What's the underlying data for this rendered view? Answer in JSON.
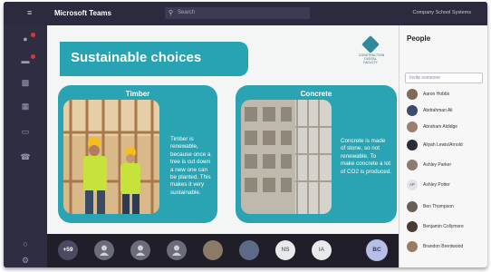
{
  "topbar": {
    "app_title": "Microsoft Teams",
    "search_placeholder": "Search",
    "org_name": "Company School Systems"
  },
  "slide": {
    "title": "Sustainable choices",
    "logo_caption": "CONSTRUCTION DIGITAL FACULTY",
    "timber": {
      "heading": "Timber",
      "text": "Timber is renewable, because once a tree is cut down a new one can be planted. This makes it very sustainable."
    },
    "concrete": {
      "heading": "Concrete",
      "text": "Concrete is made of stone, so not renewable. To make concrete a lot of CO2 is produced."
    }
  },
  "gallery": {
    "more_count": "+59",
    "initials": [
      "NS",
      "IA"
    ],
    "self_initials": "BC"
  },
  "people_panel": {
    "title": "People",
    "invite_placeholder": "Invite someone",
    "participants": [
      "Aaron Hobbs",
      "Abdrahman Ali",
      "Abraham Aldidge",
      "Aliyah Lewis/Arnold",
      "Ashley Parker",
      "Ashley Potter",
      "Ben Thompson",
      "Benjamin Collymore",
      "Brandon Brentwood"
    ],
    "participant_initials": {
      "5": "AP"
    }
  },
  "colors": {
    "slide_accent": "#27a3b3",
    "teams_bar": "#2b2a3f",
    "rail": "#2e2d41"
  }
}
